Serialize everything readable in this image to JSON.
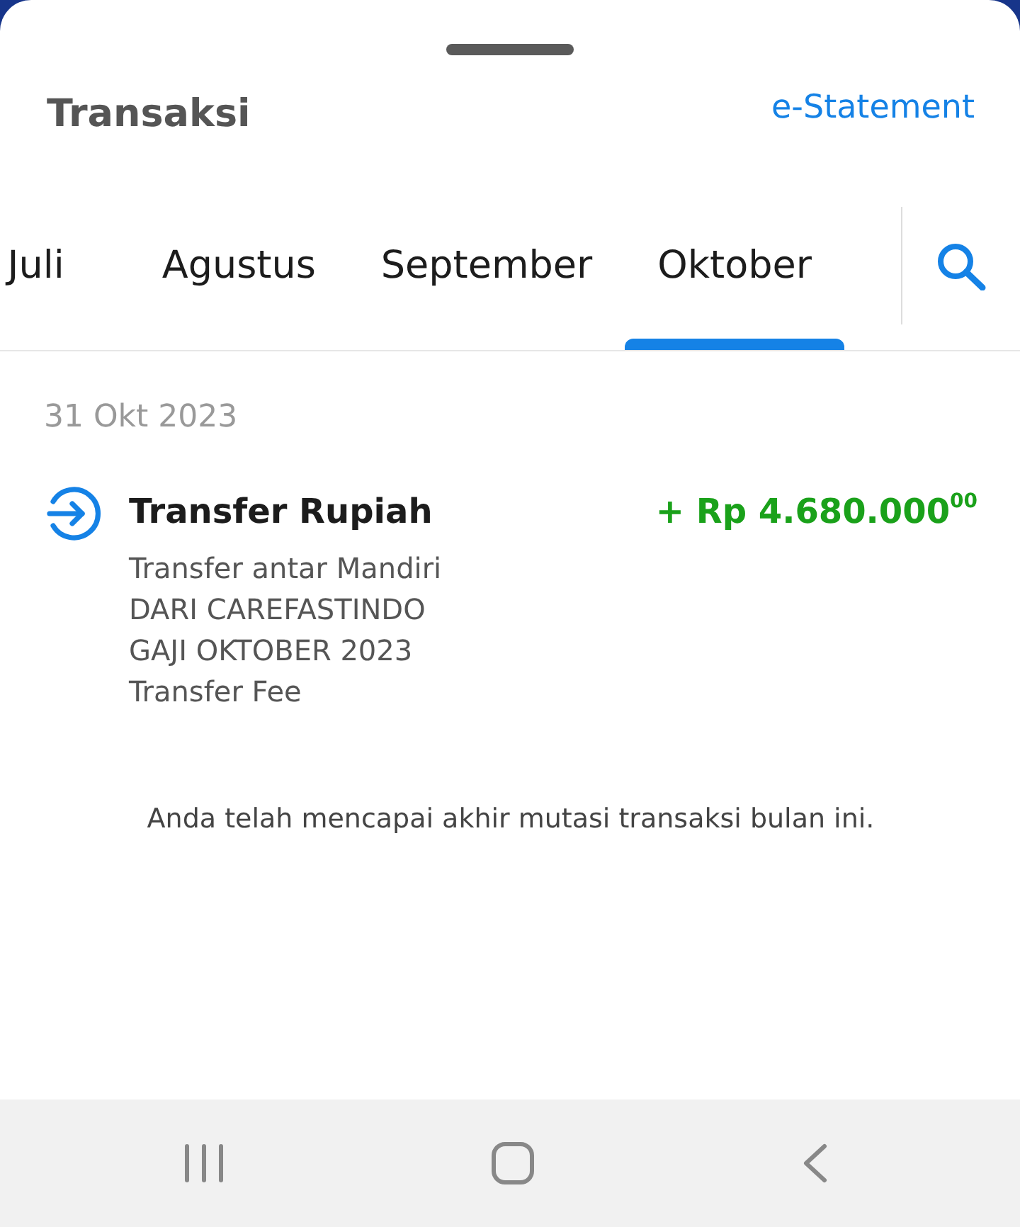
{
  "sheet": {
    "title": "Transaksi",
    "link": "e-Statement"
  },
  "tabs": [
    {
      "label": "Juli",
      "selected": false
    },
    {
      "label": "Agustus",
      "selected": false
    },
    {
      "label": "September",
      "selected": false
    },
    {
      "label": "Oktober",
      "selected": true
    }
  ],
  "groups": [
    {
      "date": "31 Okt 2023",
      "transactions": [
        {
          "kind": "credit",
          "title": "Transfer Rupiah",
          "amount": "+ Rp 4.680.000$^{00}$",
          "details": [
            "Transfer antar Mandiri",
            "DARI CAREFASTINDO",
            "GAJI OKTOBER 2023",
            "Transfer Fee"
          ]
        }
      ]
    }
  ],
  "end_note": "Anda telah mencapai akhir mutasi transaksi bulan ini."
}
